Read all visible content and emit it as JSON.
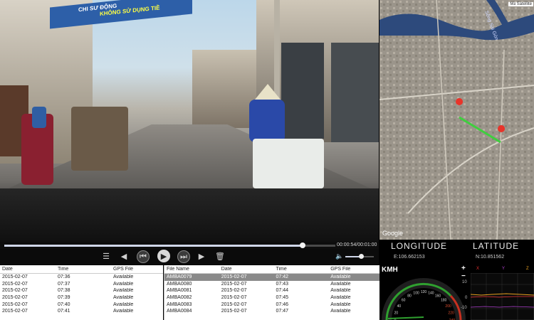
{
  "video": {
    "banner_line1": "CHI SƯ ĐỘNG",
    "banner_line2": "KHÔNG SỬ DỤNG TIỀ",
    "time_readout": "00:00:54/00:01:00",
    "progress": 0.9
  },
  "toolbar": {
    "icons": [
      "playlist-icon",
      "previous-icon",
      "rewind-icon",
      "play-icon",
      "fast-forward-icon",
      "next-icon",
      "delete-icon"
    ],
    "volume_icon": "speaker-icon",
    "volume_level": 0.55
  },
  "left_table": {
    "headers": [
      "Date",
      "Time",
      "GPS File"
    ],
    "rows": [
      [
        "2015-02-07",
        "07:36",
        "Available"
      ],
      [
        "2015-02-07",
        "07:37",
        "Available"
      ],
      [
        "2015-02-07",
        "07:38",
        "Available"
      ],
      [
        "2015-02-07",
        "07:39",
        "Available"
      ],
      [
        "2015-02-07",
        "07:40",
        "Available"
      ],
      [
        "2015-02-07",
        "07:41",
        "Available"
      ]
    ]
  },
  "file_table": {
    "headers": [
      "File Name",
      "Date",
      "Time",
      "GPS File"
    ],
    "rows": [
      [
        "AMBA0079",
        "2015-02-07",
        "07:42",
        "Available"
      ],
      [
        "AMBA0080",
        "2015-02-07",
        "07:43",
        "Available"
      ],
      [
        "AMBA0081",
        "2015-02-07",
        "07:44",
        "Available"
      ],
      [
        "AMBA0082",
        "2015-02-07",
        "07:45",
        "Available"
      ],
      [
        "AMBA0083",
        "2015-02-07",
        "07:46",
        "Available"
      ],
      [
        "AMBA0084",
        "2015-02-07",
        "07:47",
        "Available"
      ]
    ],
    "selected_index": 0
  },
  "map": {
    "type_buttons": [
      "Map",
      "Satellite"
    ],
    "river_label": "Sông Sài Gòn",
    "google_label": "Google"
  },
  "coords": {
    "longitude_label": "LONGITUDE",
    "latitude_label": "LATITUDE",
    "longitude_value": "E:106.662153",
    "latitude_value": "N:10.851562"
  },
  "gauge": {
    "unit": "KMH",
    "labels": [
      "0",
      "20",
      "40",
      "60",
      "80",
      "100",
      "120",
      "140",
      "160",
      "180",
      "200",
      "220",
      "240"
    ],
    "speed_value": 0
  },
  "graph": {
    "plus": "+",
    "minus": "−",
    "axis_labels": [
      "X",
      "Y",
      "Z"
    ],
    "y_labels": [
      "10",
      "0",
      "-10"
    ],
    "colors": {
      "x": "#e83030",
      "y": "#b040d0",
      "z": "#e8a020"
    }
  },
  "colors": {
    "accent": "#cfd6e8",
    "route": "#3ecf3e",
    "marker": "#e8342a",
    "gauge_green": "#2fa02f"
  }
}
